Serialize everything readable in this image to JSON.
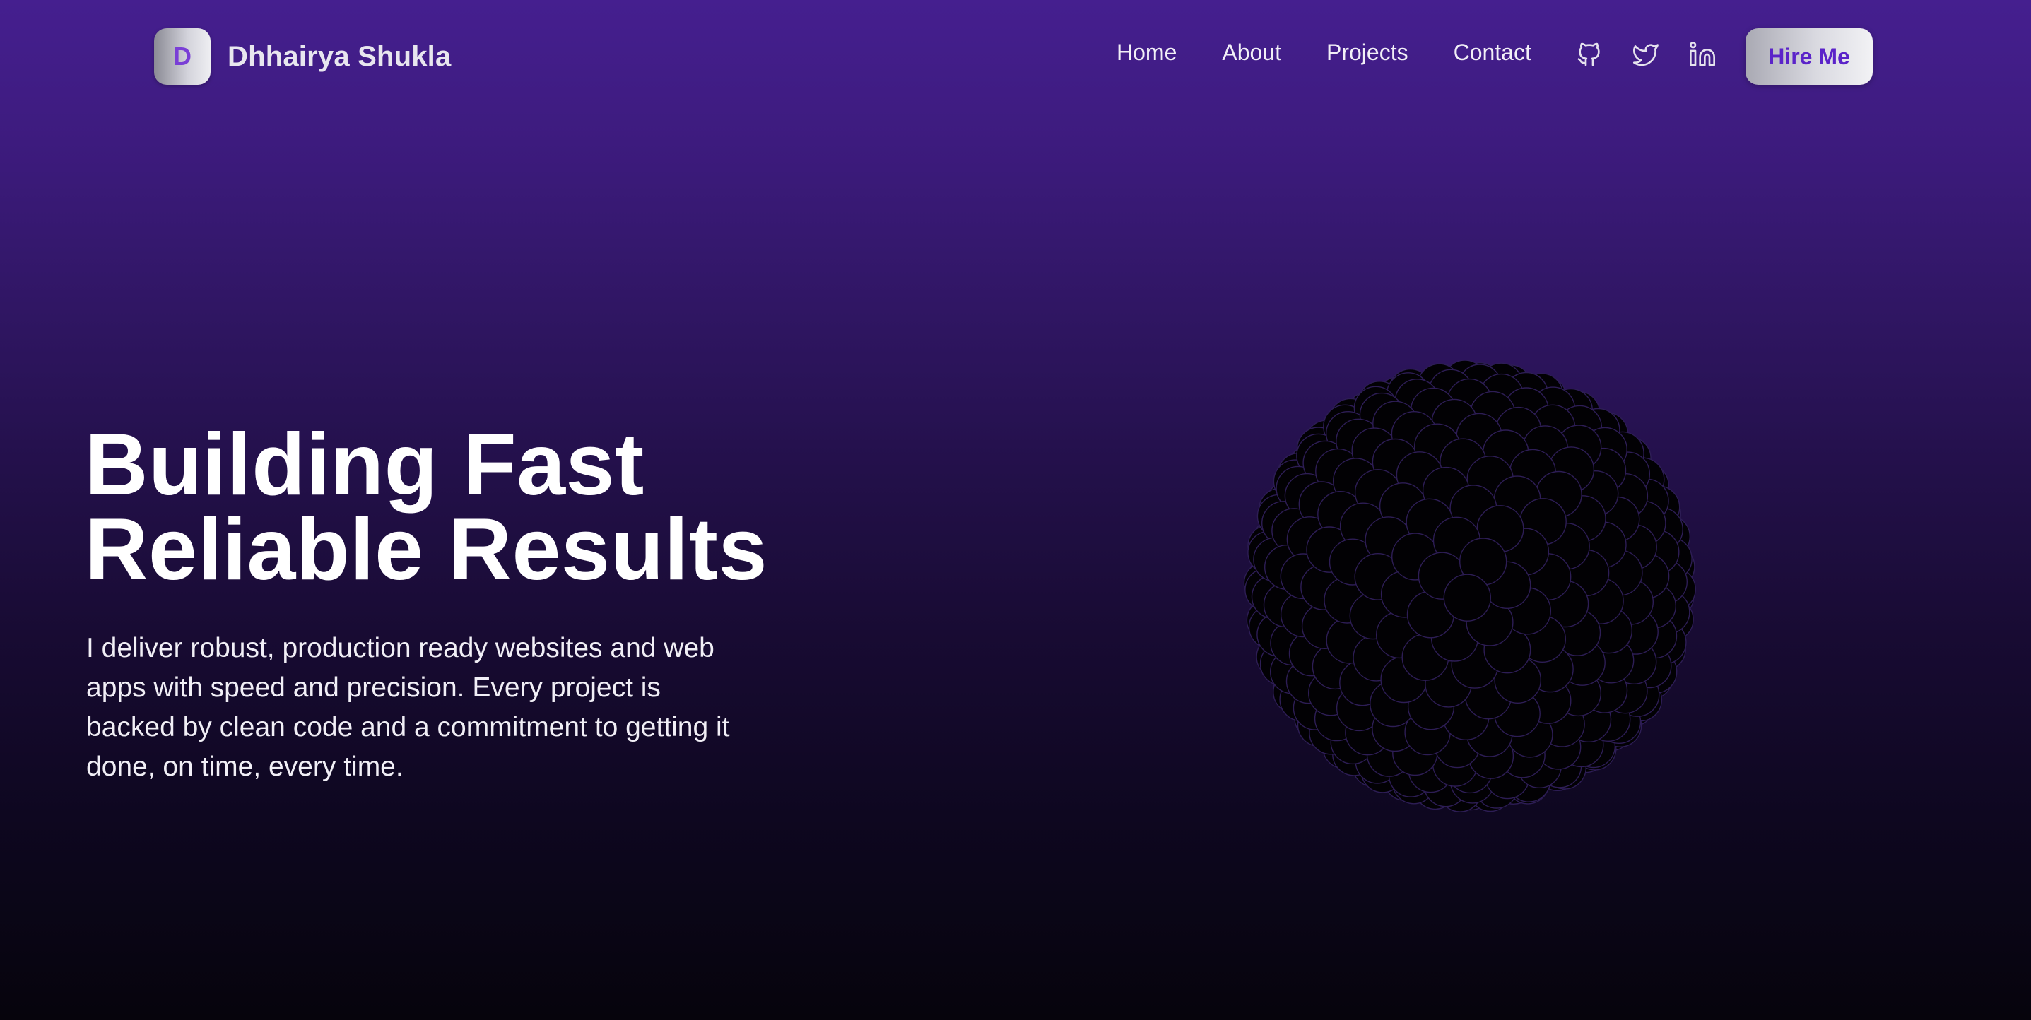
{
  "header": {
    "logo_letter": "D",
    "brand_name": "Dhhairya Shukla",
    "nav": [
      {
        "label": "Home"
      },
      {
        "label": "About"
      },
      {
        "label": "Projects"
      },
      {
        "label": "Contact"
      }
    ],
    "social": [
      {
        "icon": "github-icon"
      },
      {
        "icon": "twitter-icon"
      },
      {
        "icon": "linkedin-icon"
      }
    ],
    "cta_label": "Hire Me"
  },
  "hero": {
    "title_line1": "Building Fast",
    "title_line2": "Reliable Results",
    "description": "I deliver robust, production ready websites and web apps with speed and precision. Every project is backed by clean code and a commitment to getting it done, on time, every time."
  },
  "colors": {
    "bg_top": "#451f8f",
    "bg_bottom": "#06040c",
    "accent": "#5b23c9",
    "text": "#ffffff"
  }
}
